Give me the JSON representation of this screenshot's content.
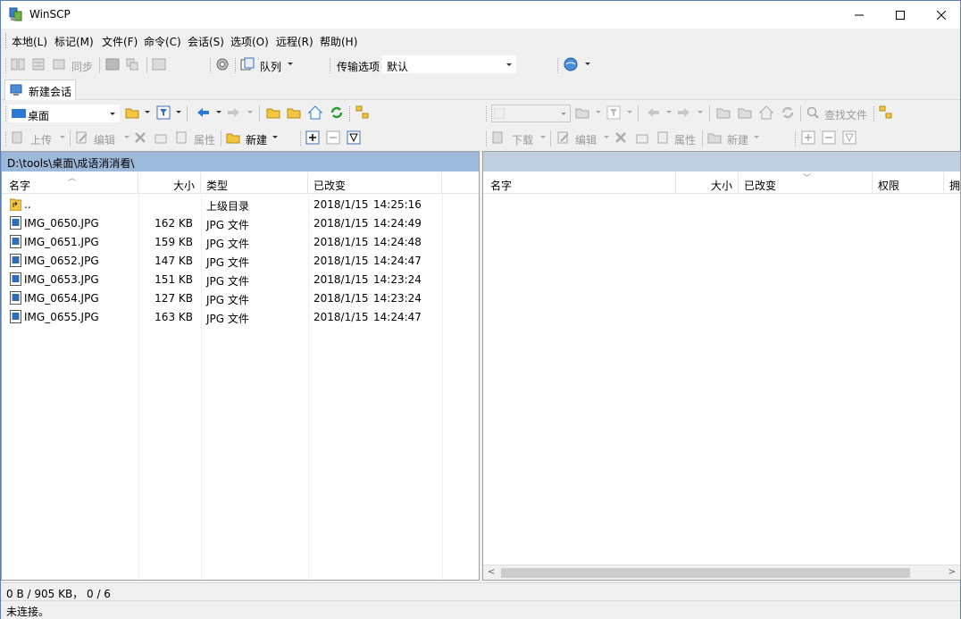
{
  "window": {
    "title": "WinSCP"
  },
  "menu": [
    "本地(L)",
    "标记(M)",
    "文件(F)",
    "命令(C)",
    "会话(S)",
    "选项(O)",
    "远程(R)",
    "帮助(H)"
  ],
  "toolbar1": {
    "sync_label": "同步",
    "queue_label": "队列",
    "transfer_options_label": "传输选项",
    "transfer_options_value": "默认"
  },
  "session": {
    "tab_label": "新建会话"
  },
  "left_nav": {
    "location": "桌面"
  },
  "left_actions": {
    "upload": "上传",
    "edit": "编辑",
    "properties": "属性",
    "new": "新建"
  },
  "right_nav": {
    "find_files": "查找文件"
  },
  "right_actions": {
    "download": "下载",
    "edit": "编辑",
    "properties": "属性",
    "new": "新建"
  },
  "left_panel": {
    "path": "D:\\tools\\桌面\\成语消消看\\",
    "columns": {
      "name": "名字",
      "size": "大小",
      "type": "类型",
      "changed": "已改变"
    },
    "rows": [
      {
        "name": "..",
        "size": "",
        "type": "上级目录",
        "date": "2018/1/15",
        "time": "14:25:16",
        "icon": "parent-dir-icon"
      },
      {
        "name": "IMG_0650.JPG",
        "size": "162 KB",
        "type": "JPG 文件",
        "date": "2018/1/15",
        "time": "14:24:49",
        "icon": "image-file-icon"
      },
      {
        "name": "IMG_0651.JPG",
        "size": "159 KB",
        "type": "JPG 文件",
        "date": "2018/1/15",
        "time": "14:24:48",
        "icon": "image-file-icon"
      },
      {
        "name": "IMG_0652.JPG",
        "size": "147 KB",
        "type": "JPG 文件",
        "date": "2018/1/15",
        "time": "14:24:47",
        "icon": "image-file-icon"
      },
      {
        "name": "IMG_0653.JPG",
        "size": "151 KB",
        "type": "JPG 文件",
        "date": "2018/1/15",
        "time": "14:23:24",
        "icon": "image-file-icon"
      },
      {
        "name": "IMG_0654.JPG",
        "size": "127 KB",
        "type": "JPG 文件",
        "date": "2018/1/15",
        "time": "14:23:24",
        "icon": "image-file-icon"
      },
      {
        "name": "IMG_0655.JPG",
        "size": "163 KB",
        "type": "JPG 文件",
        "date": "2018/1/15",
        "time": "14:24:47",
        "icon": "image-file-icon"
      }
    ]
  },
  "right_panel": {
    "path": "",
    "columns": {
      "name": "名字",
      "size": "大小",
      "changed": "已改变",
      "permissions": "权限",
      "owner": "拥"
    }
  },
  "status": {
    "selection": "0 B / 905 KB， 0 / 6",
    "connection": "未连接。"
  },
  "colors": {
    "path_active": "#9db9d9",
    "path_inactive": "#bfcfe0",
    "folder_yellow": "#f5c542",
    "image_blue": "#2f6eb5"
  }
}
